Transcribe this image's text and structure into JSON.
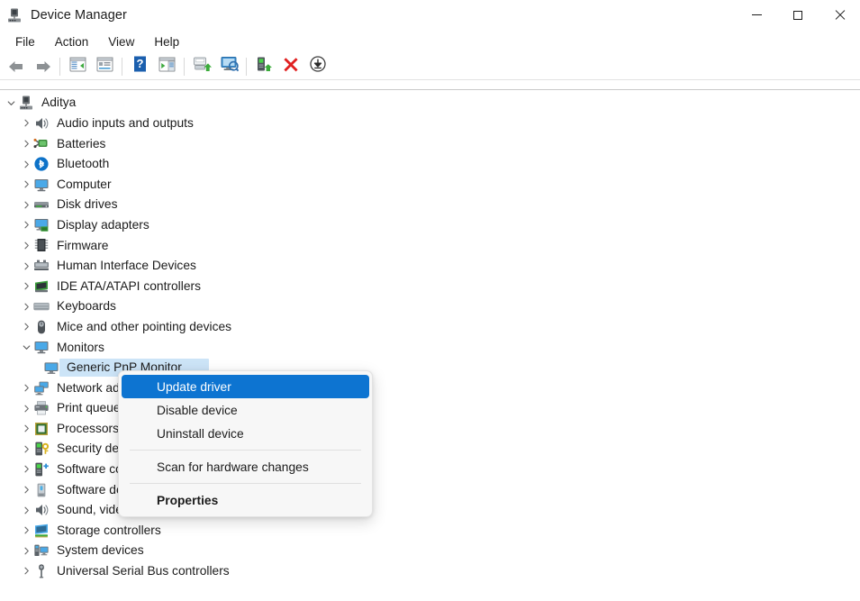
{
  "window": {
    "title": "Device Manager",
    "icon": "device-manager-icon",
    "controls": {
      "minimize": "minimize-icon",
      "maximize": "maximize-icon",
      "close": "close-icon"
    }
  },
  "menubar": {
    "items": [
      {
        "label": "File"
      },
      {
        "label": "Action"
      },
      {
        "label": "View"
      },
      {
        "label": "Help"
      }
    ]
  },
  "toolbar": {
    "buttons": [
      {
        "name": "back-arrow-icon",
        "tip": "Back"
      },
      {
        "name": "forward-arrow-icon",
        "tip": "Forward"
      },
      {
        "name": "show-hide-console-tree-icon",
        "tip": "Show/Hide Console Tree"
      },
      {
        "name": "properties-icon",
        "tip": "Properties"
      },
      {
        "name": "help-icon",
        "tip": "Help"
      },
      {
        "name": "show-hide-action-pane-icon",
        "tip": "Show/Hide Action Pane"
      },
      {
        "name": "update-driver-icon",
        "tip": "Update driver"
      },
      {
        "name": "scan-for-hardware-changes-icon",
        "tip": "Scan for hardware changes"
      },
      {
        "name": "enable-device-icon",
        "tip": "Enable device"
      },
      {
        "name": "uninstall-device-icon",
        "tip": "Uninstall device"
      },
      {
        "name": "install-legacy-hardware-icon",
        "tip": "Add legacy hardware"
      }
    ]
  },
  "tree": {
    "root": {
      "label": "Aditya",
      "icon": "computer-root-icon",
      "expanded": true
    },
    "items": [
      {
        "label": "Audio inputs and outputs",
        "icon": "speaker-icon",
        "expanded": false,
        "depth": 1
      },
      {
        "label": "Batteries",
        "icon": "battery-icon",
        "expanded": false,
        "depth": 1
      },
      {
        "label": "Bluetooth",
        "icon": "bluetooth-icon",
        "expanded": false,
        "depth": 1
      },
      {
        "label": "Computer",
        "icon": "monitor-icon",
        "expanded": false,
        "depth": 1
      },
      {
        "label": "Disk drives",
        "icon": "disk-drive-icon",
        "expanded": false,
        "depth": 1
      },
      {
        "label": "Display adapters",
        "icon": "display-adapter-icon",
        "expanded": false,
        "depth": 1
      },
      {
        "label": "Firmware",
        "icon": "firmware-chip-icon",
        "expanded": false,
        "depth": 1
      },
      {
        "label": "Human Interface Devices",
        "icon": "hid-icon",
        "expanded": false,
        "depth": 1
      },
      {
        "label": "IDE ATA/ATAPI controllers",
        "icon": "ide-controller-icon",
        "expanded": false,
        "depth": 1
      },
      {
        "label": "Keyboards",
        "icon": "keyboard-icon",
        "expanded": false,
        "depth": 1
      },
      {
        "label": "Mice and other pointing devices",
        "icon": "mouse-icon",
        "expanded": false,
        "depth": 1
      },
      {
        "label": "Monitors",
        "icon": "monitor-icon",
        "expanded": true,
        "depth": 1
      },
      {
        "label": "Generic PnP Monitor",
        "icon": "monitor-small-icon",
        "expanded": null,
        "depth": 2,
        "selected": true
      },
      {
        "label": "Network adapters",
        "icon": "network-adapter-icon",
        "expanded": false,
        "depth": 1
      },
      {
        "label": "Print queues",
        "icon": "printer-icon",
        "expanded": false,
        "depth": 1
      },
      {
        "label": "Processors",
        "icon": "processor-icon",
        "expanded": false,
        "depth": 1
      },
      {
        "label": "Security devices",
        "icon": "security-device-icon",
        "expanded": false,
        "depth": 1
      },
      {
        "label": "Software components",
        "icon": "software-component-icon",
        "expanded": false,
        "depth": 1
      },
      {
        "label": "Software devices",
        "icon": "software-device-icon",
        "expanded": false,
        "depth": 1
      },
      {
        "label": "Sound, video and game controllers",
        "icon": "speaker-icon",
        "expanded": false,
        "depth": 1
      },
      {
        "label": "Storage controllers",
        "icon": "storage-controller-icon",
        "expanded": false,
        "depth": 1
      },
      {
        "label": "System devices",
        "icon": "system-device-icon",
        "expanded": false,
        "depth": 1
      },
      {
        "label": "Universal Serial Bus controllers",
        "icon": "usb-icon",
        "expanded": false,
        "depth": 1
      }
    ]
  },
  "context_menu": {
    "items": [
      {
        "label": "Update driver",
        "highlighted": true,
        "bold": false
      },
      {
        "label": "Disable device",
        "highlighted": false,
        "bold": false
      },
      {
        "label": "Uninstall device",
        "highlighted": false,
        "bold": false
      },
      {
        "separator": true
      },
      {
        "label": "Scan for hardware changes",
        "highlighted": false,
        "bold": false
      },
      {
        "separator": true
      },
      {
        "label": "Properties",
        "highlighted": false,
        "bold": true
      }
    ]
  },
  "colors": {
    "selection_blue": "#0d74d1",
    "tree_selection": "#cce4f7",
    "menu_background": "#f7f7f7",
    "text": "#1b1b1b"
  }
}
